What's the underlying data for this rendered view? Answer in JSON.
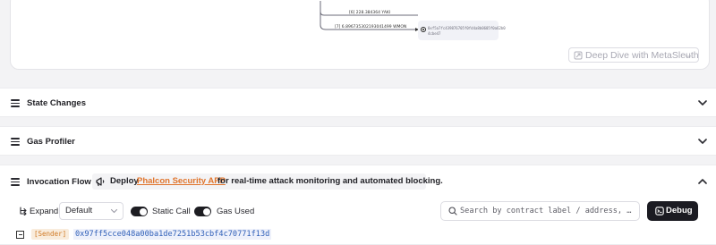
{
  "graph": {
    "edge_label_1": "[6] 228.384364 YAKI",
    "edge_label_2": "[7] 6.896735302193041499 WMON",
    "node_address_line1": "0xf5a7fc439876705f0fd4a8b0605f0a62b0",
    "node_address_line2": "4cbe47",
    "deep_dive_label": "Deep Dive with MetaSleuth",
    "deep_dive_suffix": "⇔"
  },
  "sections": {
    "state_changes": "State Changes",
    "gas_profiler": "Gas Profiler",
    "invocation_flow": "Invocation Flow"
  },
  "promo": {
    "prefix": "Deploy",
    "link": "Phalcon Security APP",
    "suffix": "for real-time attack monitoring and automated blocking."
  },
  "controls": {
    "expand_label": "Expand",
    "expand_value": "Default",
    "static_call_label": "Static Call",
    "gas_used_label": "Gas Used",
    "search_placeholder": "Search by contract label / address, …",
    "debug_label": "Debug"
  },
  "trace": {
    "sender_tag": "[Sender]",
    "sender_address": "0x97ff5cce048a00ba1de7251b53cbf4c70771f13d"
  },
  "colors": {
    "accent_link": "#e0742b",
    "sender_tag_bg": "#f9ecdc",
    "address_blue": "#2f5fb8",
    "debug_bg": "#1b1b22"
  },
  "icons": [
    "collapse-icon",
    "chevron-down-icon",
    "chevron-up-icon",
    "expand-tree-icon",
    "search-icon",
    "debug-icon",
    "megaphone-icon",
    "metasleuth-icon"
  ]
}
